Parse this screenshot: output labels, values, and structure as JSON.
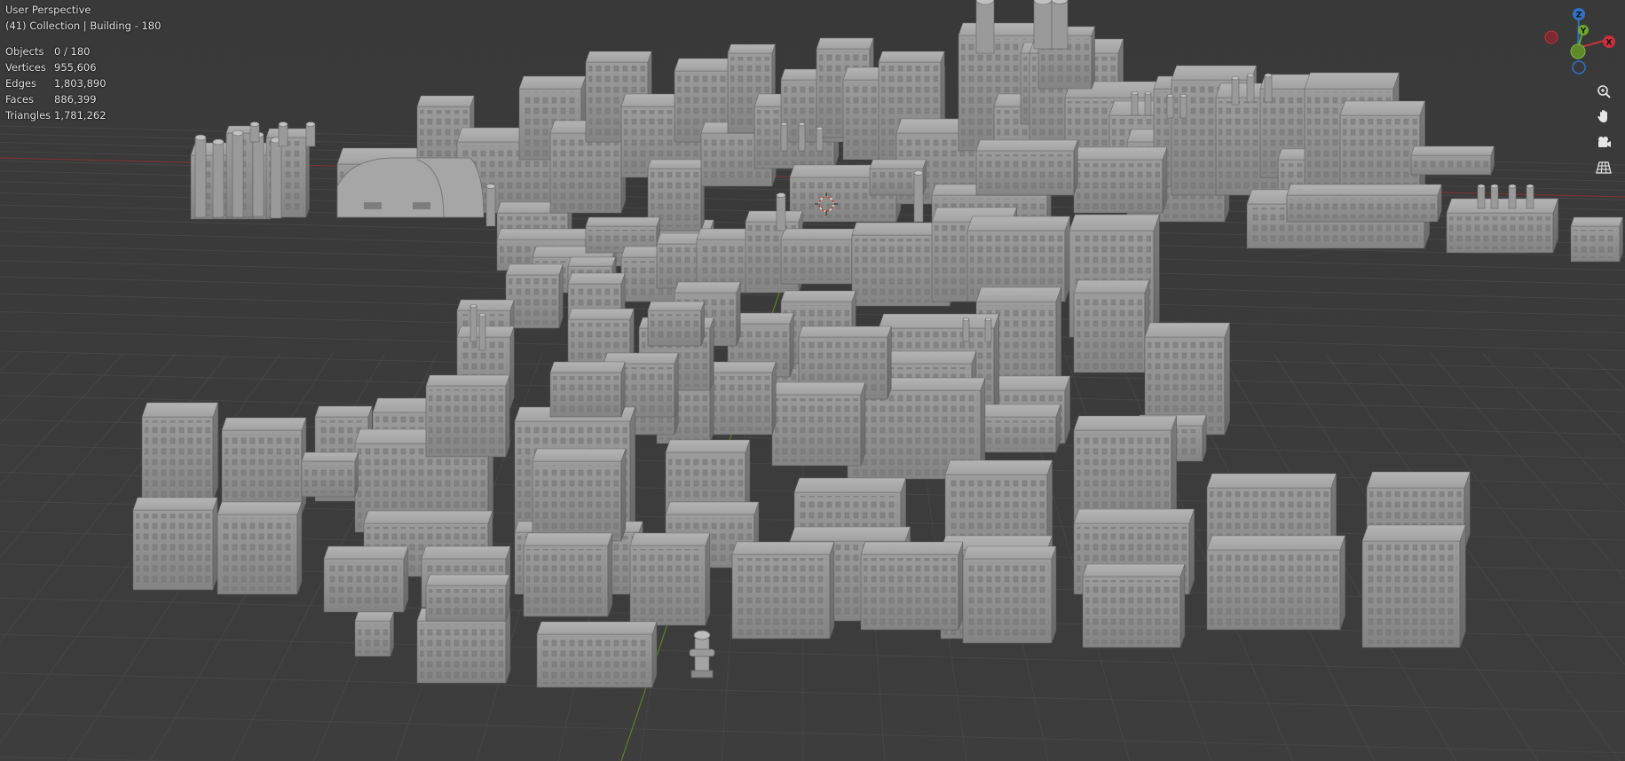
{
  "viewport": {
    "view_name": "User Perspective",
    "collection_info": "(41) Collection | Building - 180"
  },
  "stats": [
    {
      "label": "Objects",
      "value": "0 / 180"
    },
    {
      "label": "Vertices",
      "value": "955,606"
    },
    {
      "label": "Edges",
      "value": "1,803,890"
    },
    {
      "label": "Faces",
      "value": "886,399"
    },
    {
      "label": "Triangles",
      "value": "1,781,262"
    }
  ],
  "gizmo": {
    "z_label": "Z",
    "y_label": "Y",
    "x_label": "X",
    "colors": {
      "x": "#c9313c",
      "y": "#6ea82b",
      "z": "#2f71c6"
    }
  },
  "nav_tools": [
    {
      "name": "zoom",
      "icon": "zoom-icon"
    },
    {
      "name": "pan",
      "icon": "hand-icon"
    },
    {
      "name": "camera",
      "icon": "camera-icon"
    },
    {
      "name": "ortho",
      "icon": "grid-icon"
    }
  ],
  "colors": {
    "background": "#3b3b3b",
    "grid": "#454545",
    "x_axis": "#8a3535",
    "y_axis": "#5f8a2a",
    "building": "#9a9a9a"
  }
}
